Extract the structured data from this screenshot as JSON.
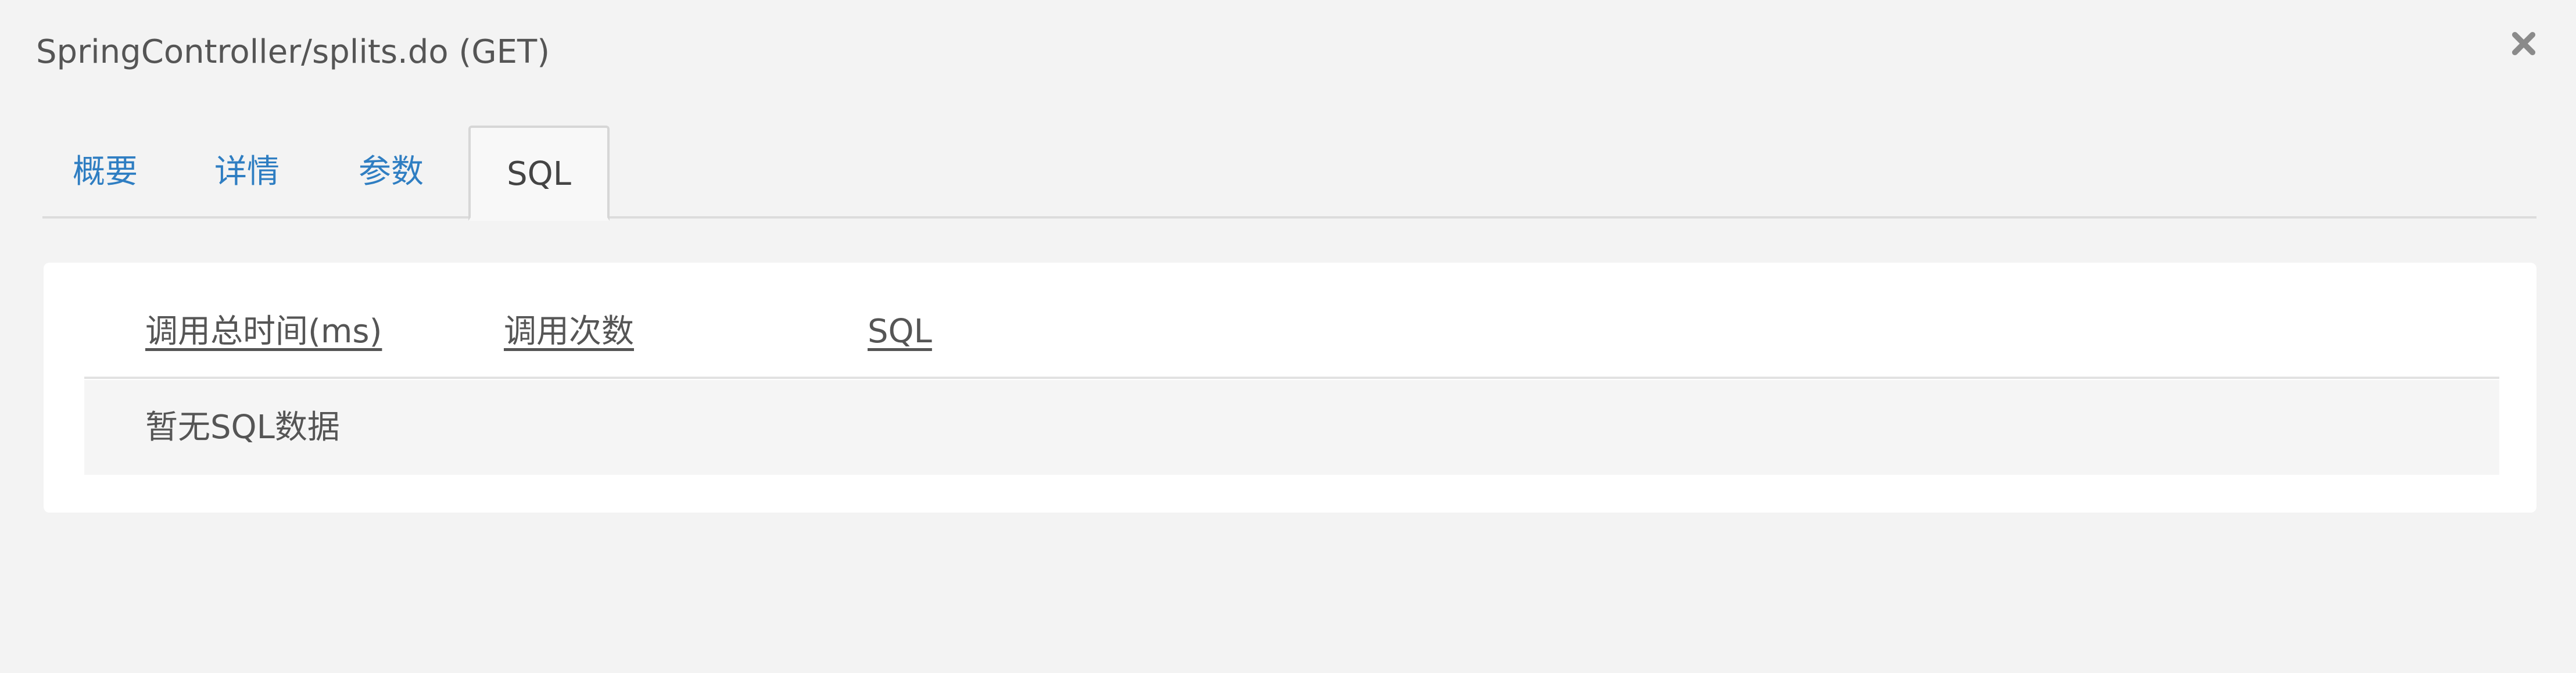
{
  "dialog": {
    "title": "SpringController/splits.do (GET)",
    "close_icon": "close-icon"
  },
  "tabs": [
    {
      "label": "概要",
      "active": false
    },
    {
      "label": "详情",
      "active": false
    },
    {
      "label": "参数",
      "active": false
    },
    {
      "label": "SQL",
      "active": true
    }
  ],
  "table": {
    "columns": [
      "调用总时间(ms)",
      "调用次数",
      "SQL"
    ],
    "empty_message": "暂无SQL数据"
  },
  "colors": {
    "link": "#2f7ec2",
    "text": "#555555",
    "background": "#f3f3f3",
    "panel": "#ffffff"
  }
}
